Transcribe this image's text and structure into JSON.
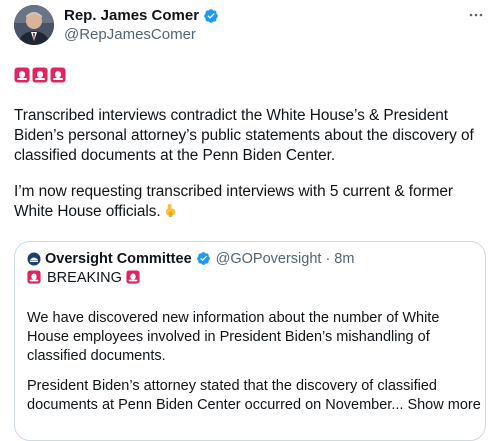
{
  "author": {
    "name": "Rep. James Comer",
    "handle": "@RepJamesComer"
  },
  "tweet": {
    "paragraph1": "Transcribed interviews contradict the White House’s & President Biden’s personal attorney’s public statements about the discovery of classified documents at the Penn Biden Center.",
    "paragraph2": "I’m now requesting transcribed interviews with 5 current & former White House officials."
  },
  "quote": {
    "name": "Oversight Committee",
    "handle": "@GOPoversight",
    "separator": "·",
    "time": "8m",
    "breaking": "BREAKING",
    "paragraph1": "We have discovered new information about the number of White House employees involved in President Biden’s mishandling of classified documents.",
    "paragraph2": "President Biden’s attorney stated that the discovery of classified documents at Penn Biden Center occurred on November...",
    "show_more": "Show more"
  },
  "colors": {
    "verified_blue": "#1d9bf0",
    "secondary_text": "#536471",
    "border": "#cfd9de",
    "siren_red": "#e0245e"
  }
}
